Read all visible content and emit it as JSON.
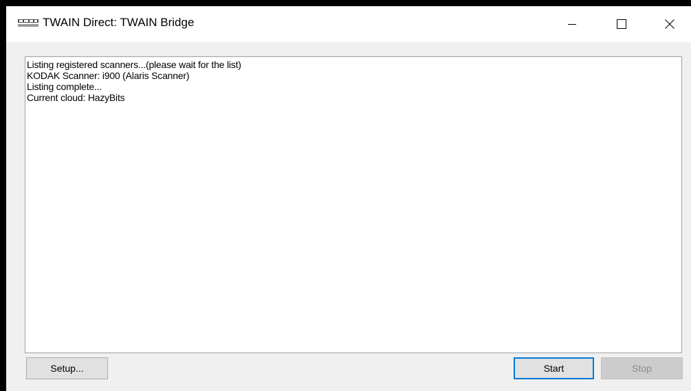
{
  "window": {
    "title": "TWAIN Direct: TWAIN Bridge",
    "icon": "twain-direct-logo"
  },
  "title_controls": {
    "minimize_icon": "minimize-icon",
    "maximize_icon": "maximize-icon",
    "close_icon": "close-icon"
  },
  "log": {
    "lines": [
      "Listing registered scanners...(please wait for the list)",
      "KODAK Scanner: i900 (Alaris Scanner)",
      "Listing complete...",
      "Current cloud: HazyBits"
    ]
  },
  "buttons": {
    "setup": "Setup...",
    "start": "Start",
    "stop": "Stop"
  },
  "colors": {
    "focus_border": "#0078d7",
    "disabled_text": "#8c8c8c"
  }
}
